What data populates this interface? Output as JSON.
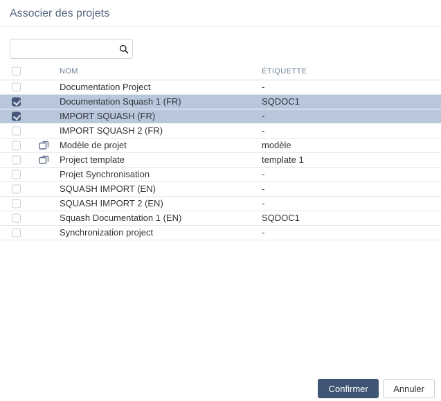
{
  "dialog": {
    "title": "Associer des projets"
  },
  "search": {
    "value": "",
    "placeholder": "",
    "icon": "search-icon"
  },
  "table": {
    "columns": {
      "name": "NOM",
      "label": "ÉTIQUETTE"
    },
    "header_checkbox_checked": false,
    "rows": [
      {
        "name": "Documentation Project",
        "label": "-",
        "checked": false,
        "selected": false,
        "template": false
      },
      {
        "name": "Documentation Squash 1 (FR)",
        "label": "SQDOC1",
        "checked": true,
        "selected": true,
        "template": false
      },
      {
        "name": "IMPORT SQUASH (FR)",
        "label": "-",
        "checked": true,
        "selected": true,
        "template": false
      },
      {
        "name": "IMPORT SQUASH 2 (FR)",
        "label": "-",
        "checked": false,
        "selected": false,
        "template": false
      },
      {
        "name": "Modèle de projet",
        "label": "modèle",
        "checked": false,
        "selected": false,
        "template": true
      },
      {
        "name": "Project template",
        "label": "template 1",
        "checked": false,
        "selected": false,
        "template": true
      },
      {
        "name": "Projet Synchronisation",
        "label": "-",
        "checked": false,
        "selected": false,
        "template": false
      },
      {
        "name": "SQUASH IMPORT (EN)",
        "label": "-",
        "checked": false,
        "selected": false,
        "template": false
      },
      {
        "name": "SQUASH IMPORT 2 (EN)",
        "label": "-",
        "checked": false,
        "selected": false,
        "template": false
      },
      {
        "name": "Squash Documentation 1 (EN)",
        "label": "SQDOC1",
        "checked": false,
        "selected": false,
        "template": false
      },
      {
        "name": "Synchronization project",
        "label": "-",
        "checked": false,
        "selected": false,
        "template": false
      }
    ]
  },
  "buttons": {
    "confirm": "Confirmer",
    "cancel": "Annuler"
  },
  "colors": {
    "accent": "#3f5573",
    "selected_row": "#b9c7dd",
    "checked_checkbox": "#45587a",
    "title_text": "#55677e",
    "header_text": "#6e8097"
  }
}
